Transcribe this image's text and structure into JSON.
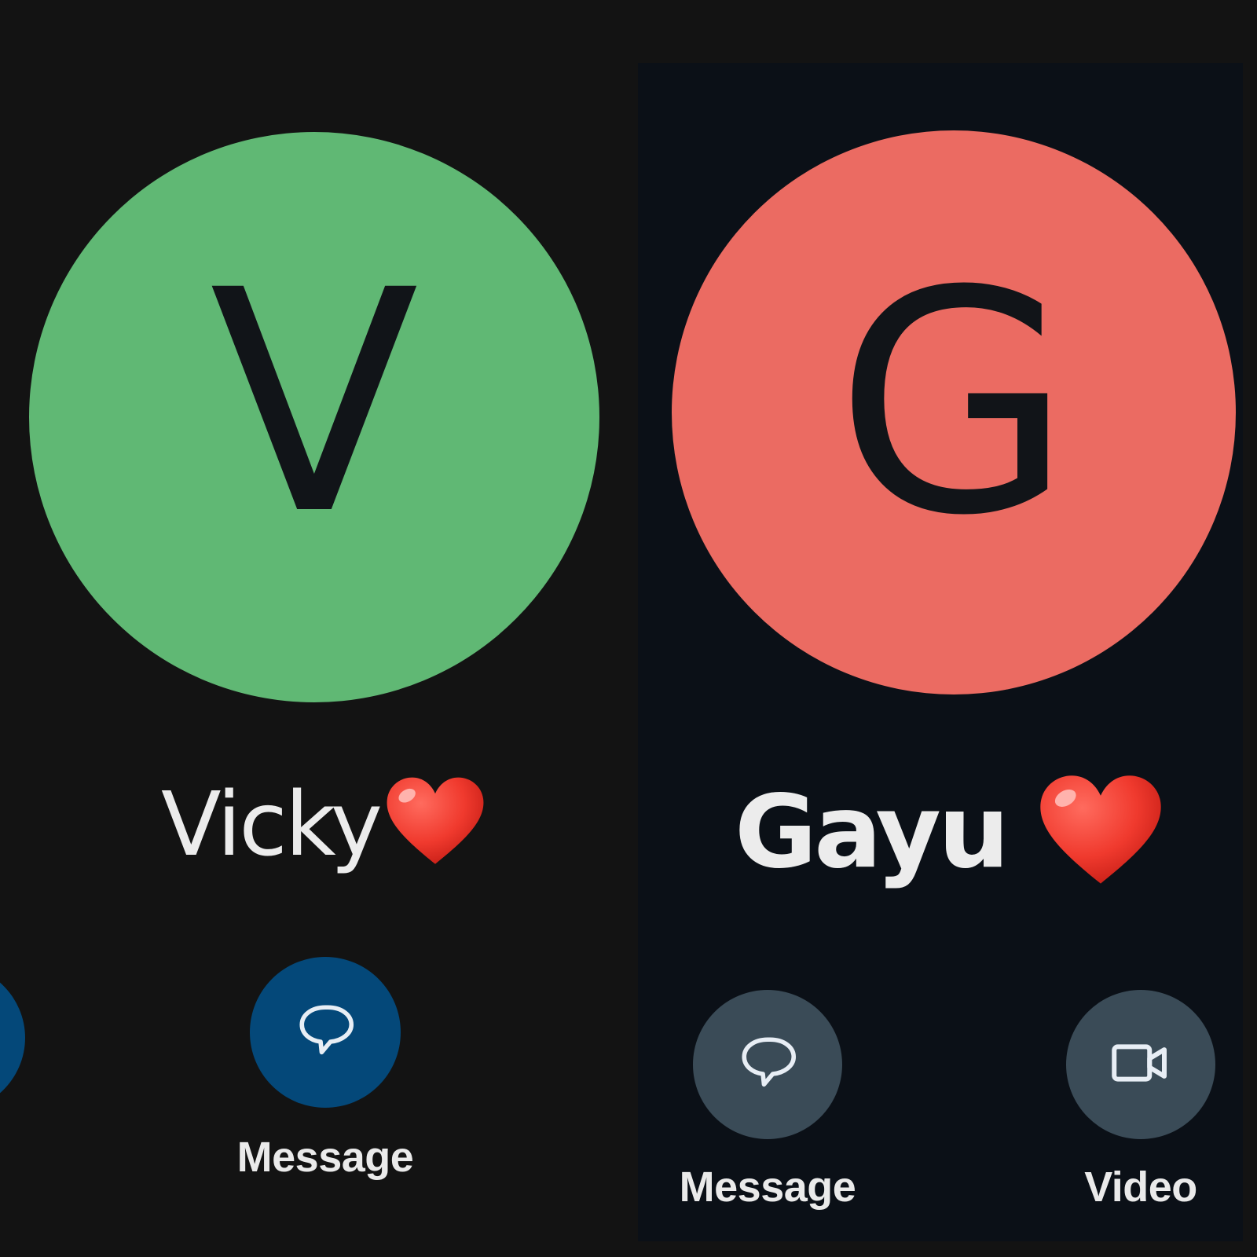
{
  "contacts": [
    {
      "initial": "V",
      "name": "Vicky",
      "avatar_color": "#60b874",
      "name_suffix_icon": "red-heart-icon",
      "actions": [
        {
          "label": "Message",
          "icon": "message-bubble-icon",
          "color": "#044879"
        }
      ]
    },
    {
      "initial": "G",
      "name": "Gayu",
      "avatar_color": "#eb6b62",
      "name_suffix_icon": "red-heart-icon",
      "actions": [
        {
          "label": "Message",
          "icon": "message-bubble-icon",
          "color": "#3a4b57"
        },
        {
          "label": "Video",
          "icon": "video-camera-icon",
          "color": "#3a4b57"
        }
      ]
    }
  ],
  "colors": {
    "background": "#131313",
    "right_panel_background": "#0b1017",
    "heart": "#f03a2e"
  }
}
